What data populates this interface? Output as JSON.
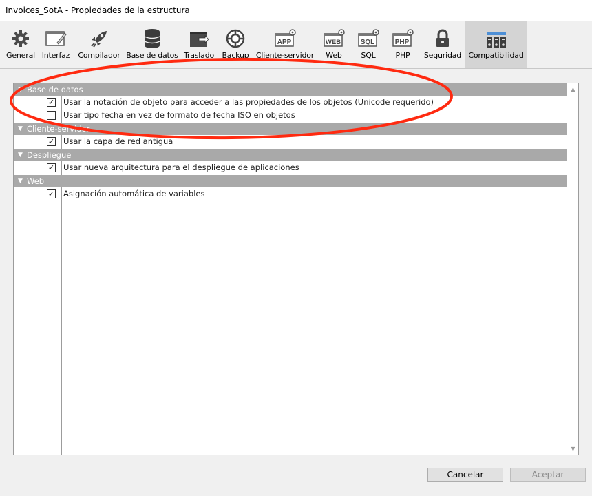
{
  "window": {
    "title": "Invoices_SotA - Propiedades de la estructura"
  },
  "toolbar": {
    "items": [
      {
        "label": "General",
        "icon": "gear-icon"
      },
      {
        "label": "Interfaz",
        "icon": "interface-icon"
      },
      {
        "label": "Compilador",
        "icon": "rocket-icon"
      },
      {
        "label": "Base de datos",
        "icon": "database-icon"
      },
      {
        "label": "Traslado",
        "icon": "transfer-icon"
      },
      {
        "label": "Backup",
        "icon": "backup-icon"
      },
      {
        "label": "Cliente-servidor",
        "icon": "app-icon",
        "badge": "APP"
      },
      {
        "label": "Web",
        "icon": "web-icon",
        "badge": "WEB"
      },
      {
        "label": "SQL",
        "icon": "sql-icon",
        "badge": "SQL"
      },
      {
        "label": "PHP",
        "icon": "php-icon",
        "badge": "PHP"
      },
      {
        "label": "Seguridad",
        "icon": "lock-icon"
      },
      {
        "label": "Compatibilidad",
        "icon": "compatibility-icon",
        "active": true
      }
    ]
  },
  "groups": [
    {
      "title": "Base de datos",
      "options": [
        {
          "label": "Usar la notación de objeto para acceder a las propiedades de los objetos (Unicode requerido)",
          "checked": true
        },
        {
          "label": "Usar tipo fecha en vez de formato de fecha ISO en objetos",
          "checked": false
        }
      ]
    },
    {
      "title": "Cliente-servidor",
      "options": [
        {
          "label": "Usar la capa de red antigua",
          "checked": true
        }
      ]
    },
    {
      "title": "Despliegue",
      "options": [
        {
          "label": "Usar nueva arquitectura para el despliegue de aplicaciones",
          "checked": true
        }
      ]
    },
    {
      "title": "Web",
      "options": [
        {
          "label": "Asignación automática de variables",
          "checked": true
        }
      ]
    }
  ],
  "buttons": {
    "cancel": "Cancelar",
    "accept": "Aceptar"
  },
  "colors": {
    "highlight_ellipse": "#ff2a10",
    "group_header": "#a9a9a9",
    "active_tab": "#d4d4d4"
  }
}
